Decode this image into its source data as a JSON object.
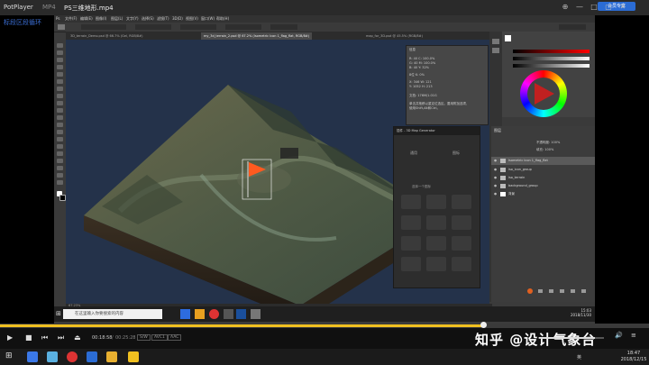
{
  "player": {
    "app_name": "PotPlayer",
    "format": "MP4",
    "file_name": "PS三维地形.mp4",
    "badge": "会员专享",
    "overlay_text": "标段区段循环",
    "time_current": "00:18:58",
    "time_total": "00:25:28",
    "badges": [
      "S/W",
      "AVC1",
      "AAC"
    ],
    "seek_progress": 0.745
  },
  "photoshop": {
    "menu": [
      "文件(F)",
      "编辑(E)",
      "图像(I)",
      "图层(L)",
      "文字(Y)",
      "选择(S)",
      "滤镜(T)",
      "3D(D)",
      "视图(V)",
      "窗口(W)",
      "帮助(H)"
    ],
    "tabs": [
      {
        "label": "3D_terrain_Demo.psd @ 66.7% (Gel, RGB/8#)",
        "active": false
      },
      {
        "label": "my_3d_terrain_2.psd @ 67.2% (Isometric Icon 1_flag_flat, RGB/8#)",
        "active": true
      },
      {
        "label": "map_for_3D.psd @ 45.5% (RGB/8#)",
        "active": false
      }
    ],
    "status_text": "67.23%",
    "info_panel": {
      "title": "信息",
      "lines": [
        "R:  40   C: 100.0%",
        "G:  40   M: 100.0%",
        "B:  40   Y:  32%",
        "8位         K:  0%",
        "X: 346   W: 121",
        "Y: 1052  H: 213",
        "文档: 176M/1.01G",
        "单击并拖移以重定位选区。要用附加选项,",
        "使用Shift,Alt和Ctrl。"
      ]
    },
    "generator_panel": {
      "title": "插件 - 3D Map Generator",
      "tab_left": "通用",
      "tab_right": "图标",
      "subtitle": "选择一个图标"
    },
    "layers_panel": {
      "title": "图层",
      "opacity_label": "不透明度: 100%",
      "fill_label": "填充: 100%",
      "layers": [
        {
          "name": "Isometric Icon 1_flag_flat",
          "selected": true
        },
        {
          "name": "iso_icon_group",
          "selected": false
        },
        {
          "name": "iso_terrain",
          "selected": false
        },
        {
          "name": "background_group",
          "selected": false
        },
        {
          "name": "背景",
          "selected": false
        }
      ]
    }
  },
  "inner_taskbar": {
    "search_placeholder": "在这里输入你要搜索的内容",
    "time": "15:03",
    "date": "2018/11/30"
  },
  "watermark": {
    "zhihu": "知乎 @设计气象台"
  },
  "host_taskbar": {
    "tray_text": "英",
    "time": "18:47",
    "date": "2018/12/15"
  },
  "colors": {
    "canvas_bg": "#24324a",
    "seek_accent": "#f0c020",
    "badge_blue": "#2b6cd4"
  }
}
